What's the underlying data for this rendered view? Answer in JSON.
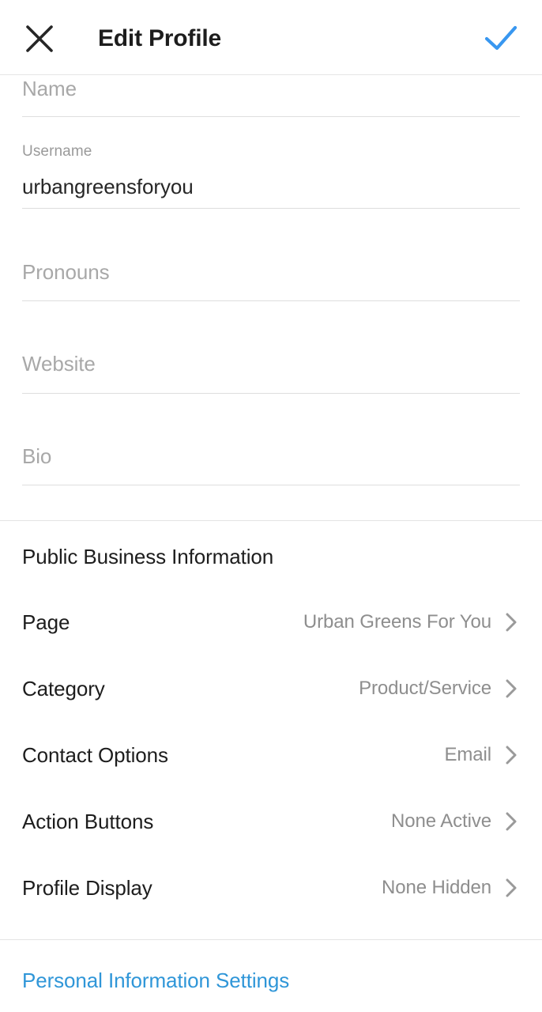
{
  "header": {
    "title": "Edit Profile",
    "close_icon": "close-x-icon",
    "confirm_icon": "checkmark-icon",
    "confirm_color": "#3897f0",
    "close_color": "#262626"
  },
  "form": {
    "fields": [
      {
        "label": "Name",
        "value": "",
        "placeholder": "Name",
        "has_value": false
      },
      {
        "label": "Username",
        "value": "urbangreensforyou",
        "placeholder": "Username",
        "has_value": true
      },
      {
        "label": "Pronouns",
        "value": "",
        "placeholder": "Pronouns",
        "has_value": false
      },
      {
        "label": "Website",
        "value": "",
        "placeholder": "Website",
        "has_value": false
      },
      {
        "label": "Bio",
        "value": "",
        "placeholder": "Bio",
        "has_value": false
      }
    ]
  },
  "business": {
    "heading": "Public Business Information",
    "rows": [
      {
        "label": "Page",
        "value": "Urban Greens For You",
        "chevron": "chevron-right-icon"
      },
      {
        "label": "Category",
        "value": "Product/Service",
        "chevron": "chevron-right-icon"
      },
      {
        "label": "Contact Options",
        "value": "Email",
        "chevron": "chevron-right-icon"
      },
      {
        "label": "Action Buttons",
        "value": "None Active",
        "chevron": "chevron-right-icon"
      },
      {
        "label": "Profile Display",
        "value": "None Hidden",
        "chevron": "chevron-right-icon"
      }
    ]
  },
  "footer": {
    "link_label": "Personal Information Settings",
    "link_color": "#2f96d8"
  },
  "colors": {
    "background": "#ffffff",
    "primary_text": "#1d1d1d",
    "secondary_text": "#8e8e8e",
    "placeholder_text": "#a8a8a8",
    "divider": "#e4e4e4",
    "underline": "#dedede",
    "accent_blue": "#3897f0"
  }
}
